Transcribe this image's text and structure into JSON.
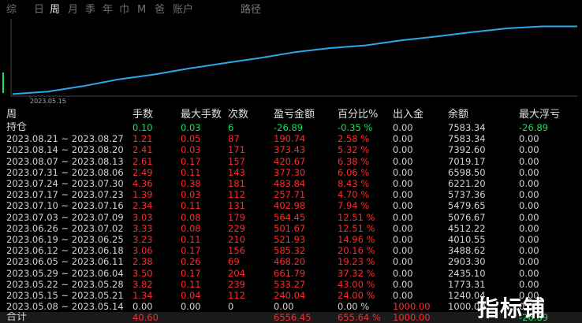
{
  "tabs": [
    "综",
    "日",
    "周",
    "月",
    "季",
    "年",
    "巾",
    "M",
    "爸",
    "账户"
  ],
  "active_tab_index": 2,
  "right_label": "路径",
  "chart": {
    "tick_label": "2023.05.15",
    "line_color": "#2aa8e8",
    "marker_color": "#1ee05a"
  },
  "chart_data": {
    "type": "line",
    "x": [
      "2023.05.08",
      "2023.05.15",
      "2023.05.22",
      "2023.05.29",
      "2023.06.05",
      "2023.06.12",
      "2023.06.19",
      "2023.06.26",
      "2023.07.03",
      "2023.07.10",
      "2023.07.17",
      "2023.07.24",
      "2023.07.31",
      "2023.08.07",
      "2023.08.14",
      "2023.08.21",
      "持仓"
    ],
    "series": [
      {
        "values": [
          1000.0,
          1240.04,
          1773.31,
          2435.1,
          2903.3,
          3488.62,
          4010.55,
          4512.22,
          5076.67,
          5479.65,
          5737.36,
          6221.2,
          6598.5,
          7019.17,
          7392.6,
          7583.34,
          7583.34
        ]
      }
    ],
    "xticks": [
      "2023.05.15"
    ]
  },
  "table": {
    "headers": [
      "周",
      "手数",
      "最大手数",
      "次数",
      "盈亏金额",
      "百分比%",
      "出入金",
      "余额",
      "最大浮亏"
    ],
    "position_row": {
      "label": "持仓",
      "cells": [
        "0.10",
        "0.03",
        "6",
        "-26.89",
        "-0.35 %",
        "0.00",
        "7583.34",
        "-26.89"
      ]
    },
    "rows": [
      {
        "label": "2023.08.21 ~ 2023.08.27",
        "cells": [
          "1.21",
          "0.05",
          "87",
          "190.74",
          "2.58 %",
          "0.00",
          "7583.34",
          "0.00"
        ]
      },
      {
        "label": "2023.08.14 ~ 2023.08.20",
        "cells": [
          "2.41",
          "0.03",
          "171",
          "373.43",
          "5.32 %",
          "0.00",
          "7392.60",
          "0.00"
        ]
      },
      {
        "label": "2023.08.07 ~ 2023.08.13",
        "cells": [
          "2.61",
          "0.17",
          "157",
          "420.67",
          "6.38 %",
          "0.00",
          "7019.17",
          "0.00"
        ]
      },
      {
        "label": "2023.07.31 ~ 2023.08.06",
        "cells": [
          "2.49",
          "0.11",
          "143",
          "377.30",
          "6.06 %",
          "0.00",
          "6598.50",
          "0.00"
        ]
      },
      {
        "label": "2023.07.24 ~ 2023.07.30",
        "cells": [
          "4.36",
          "0.38",
          "181",
          "483.84",
          "8.43 %",
          "0.00",
          "6221.20",
          "0.00"
        ]
      },
      {
        "label": "2023.07.17 ~ 2023.07.23",
        "cells": [
          "1.39",
          "0.03",
          "112",
          "257.71",
          "4.70 %",
          "0.00",
          "5737.36",
          "0.00"
        ]
      },
      {
        "label": "2023.07.10 ~ 2023.07.16",
        "cells": [
          "2.34",
          "0.11",
          "131",
          "402.98",
          "7.94 %",
          "0.00",
          "5479.65",
          "0.00"
        ]
      },
      {
        "label": "2023.07.03 ~ 2023.07.09",
        "cells": [
          "3.03",
          "0.08",
          "179",
          "564.45",
          "12.51 %",
          "0.00",
          "5076.67",
          "0.00"
        ]
      },
      {
        "label": "2023.06.26 ~ 2023.07.02",
        "cells": [
          "3.33",
          "0.08",
          "229",
          "501.67",
          "12.51 %",
          "0.00",
          "4512.22",
          "0.00"
        ]
      },
      {
        "label": "2023.06.19 ~ 2023.06.25",
        "cells": [
          "3.23",
          "0.11",
          "210",
          "521.93",
          "14.96 %",
          "0.00",
          "4010.55",
          "0.00"
        ]
      },
      {
        "label": "2023.06.12 ~ 2023.06.18",
        "cells": [
          "3.06",
          "0.17",
          "156",
          "585.32",
          "20.16 %",
          "0.00",
          "3488.62",
          "0.00"
        ]
      },
      {
        "label": "2023.06.05 ~ 2023.06.11",
        "cells": [
          "2.38",
          "0.26",
          "69",
          "468.20",
          "19.23 %",
          "0.00",
          "2903.30",
          "0.00"
        ]
      },
      {
        "label": "2023.05.29 ~ 2023.06.04",
        "cells": [
          "3.50",
          "0.17",
          "204",
          "661.79",
          "37.32 %",
          "0.00",
          "2435.10",
          "0.00"
        ]
      },
      {
        "label": "2023.05.22 ~ 2023.05.28",
        "cells": [
          "3.82",
          "0.11",
          "239",
          "533.27",
          "43.00 %",
          "0.00",
          "1773.31",
          "0.00"
        ]
      },
      {
        "label": "2023.05.15 ~ 2023.05.21",
        "cells": [
          "1.34",
          "0.04",
          "112",
          "240.04",
          "24.00 %",
          "0.00",
          "1240.04",
          "0.00"
        ]
      },
      {
        "label": "2023.05.08 ~ 2023.05.14",
        "cells": [
          "0.00",
          "0.00",
          "0",
          "0.00",
          "0.00 %",
          "1000.00",
          "1000.00",
          "0.00"
        ]
      }
    ],
    "footer": {
      "label": "合计",
      "cells": [
        "40.60",
        "",
        "",
        "6556.45",
        "655.64 %",
        "1000.00",
        "",
        "-26.89"
      ]
    }
  },
  "watermark": "指标铺"
}
